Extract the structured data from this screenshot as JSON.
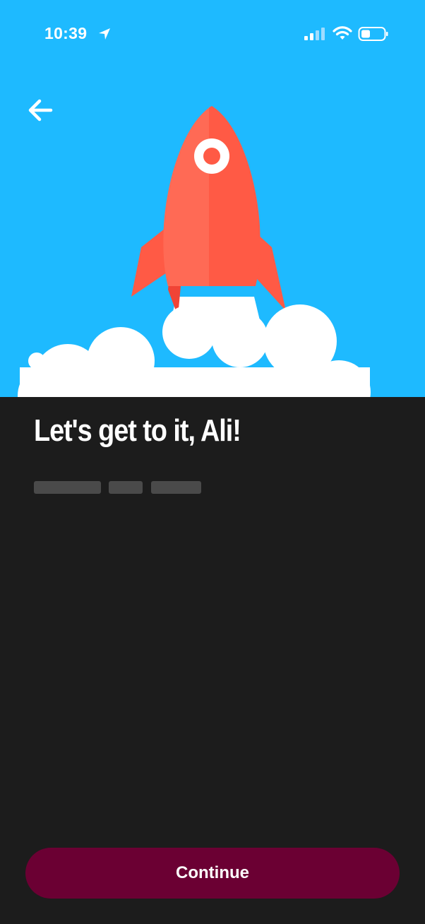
{
  "status_bar": {
    "time": "10:39",
    "icons": [
      "location-arrow-icon",
      "cellular-signal-icon",
      "wifi-icon",
      "battery-icon"
    ]
  },
  "header": {
    "back_icon": "arrow-left-icon"
  },
  "hero": {
    "illustration": "rocket-launch-illustration",
    "background_color": "#1ebaff",
    "rocket_color": "#ff5a45",
    "cloud_color": "#ffffff"
  },
  "main": {
    "title": "Let's get to it, Ali!",
    "loading_placeholder_count": 3
  },
  "footer": {
    "continue_label": "Continue",
    "button_color": "#6b0033"
  },
  "colors": {
    "page_background": "#1c1c1c",
    "placeholder": "#4a4a4a"
  }
}
